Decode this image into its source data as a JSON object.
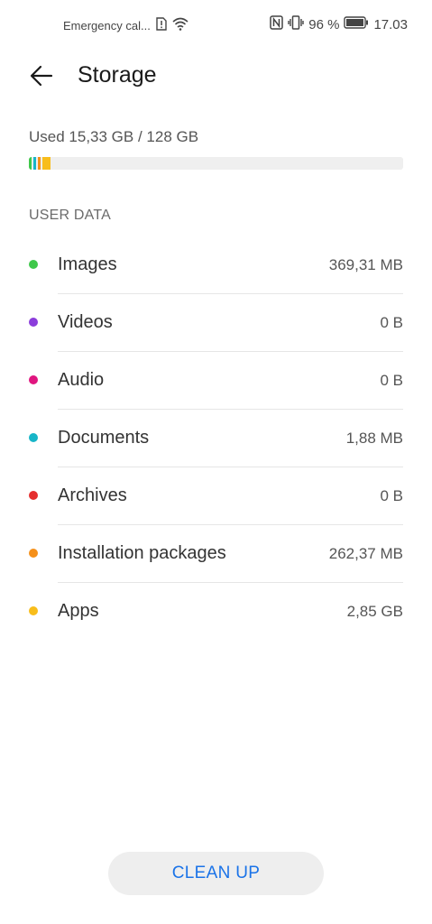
{
  "status_bar": {
    "carrier": "Emergency cal...",
    "battery": "96 %",
    "time": "17.03",
    "icons": [
      "sim-alert-icon",
      "wifi-icon",
      "nfc-icon",
      "vibrate-icon",
      "battery-icon"
    ]
  },
  "header": {
    "title": "Storage",
    "back_icon": "arrow-left-icon"
  },
  "usage": {
    "text": "Used 15,33 GB / 128 GB",
    "used_fraction": 0.1198,
    "bar_segments": [
      {
        "category": "Images",
        "color": "#3fc84a",
        "fraction": 0.003
      },
      {
        "category": "Documents",
        "color": "#17b5c8",
        "fraction": 0.0015
      },
      {
        "category": "Installation packages",
        "color": "#f5901a",
        "fraction": 0.002
      },
      {
        "category": "Apps",
        "color": "#f8bd1b",
        "fraction": 0.022
      }
    ]
  },
  "section": {
    "title": "USER DATA"
  },
  "categories": [
    {
      "label": "Images",
      "value": "369,31 MB",
      "color": "#3fc84a"
    },
    {
      "label": "Videos",
      "value": "0 B",
      "color": "#8b3ddb"
    },
    {
      "label": "Audio",
      "value": "0 B",
      "color": "#e0157f"
    },
    {
      "label": "Documents",
      "value": "1,88 MB",
      "color": "#17b5c8"
    },
    {
      "label": "Archives",
      "value": "0 B",
      "color": "#e52e2e"
    },
    {
      "label": "Installation packages",
      "value": "262,37 MB",
      "color": "#f5901a"
    },
    {
      "label": "Apps",
      "value": "2,85 GB",
      "color": "#f8bd1b"
    }
  ],
  "actions": {
    "cleanup_label": "CLEAN UP",
    "accent": "#1a73e8"
  }
}
